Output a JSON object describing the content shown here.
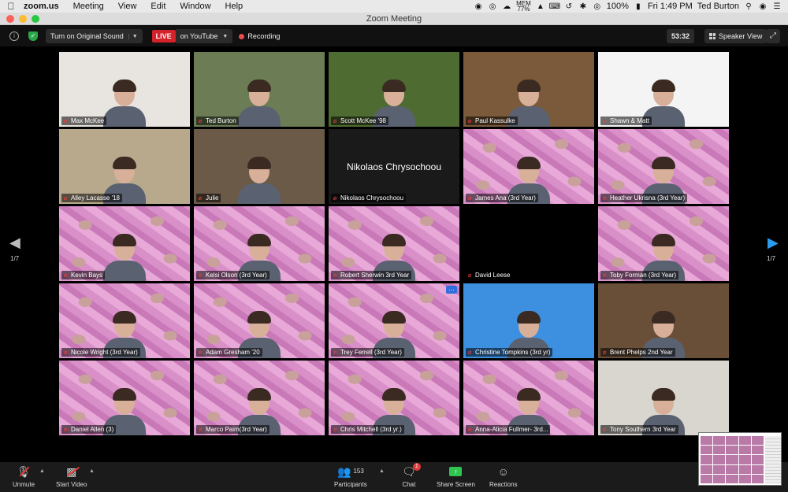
{
  "menubar": {
    "app": "zoom.us",
    "items": [
      "Meeting",
      "View",
      "Edit",
      "Window",
      "Help"
    ],
    "mem_label": "MEM",
    "mem_value": "77%",
    "battery": "100%",
    "datetime": "Fri 1:49 PM",
    "user": "Ted Burton"
  },
  "window": {
    "title": "Zoom Meeting"
  },
  "topbar": {
    "audio_button": "Turn on Original Sound",
    "live_badge": "LIVE",
    "live_target": "on YouTube",
    "recording": "Recording",
    "timer": "53:32",
    "view_button": "Speaker View"
  },
  "nav": {
    "page_left": "1/7",
    "page_right": "1/7"
  },
  "participants": [
    {
      "name": "Max McKee",
      "bg": "#e8e4df"
    },
    {
      "name": "Ted Burton",
      "bg": "#6c7d55"
    },
    {
      "name": "Scott McKee '98",
      "bg": "#4e6b32",
      "active": true
    },
    {
      "name": "Paul Kassulke",
      "bg": "#7a5a3a"
    },
    {
      "name": "Shawn & Matt",
      "bg": "#f4f4f4"
    },
    {
      "name": "Alley Lacasse '18",
      "bg": "#b9a98c"
    },
    {
      "name": "Julie",
      "bg": "#6b5a47"
    },
    {
      "name": "Nikolaos Chrysochoou",
      "video_off": true
    },
    {
      "name": "James Ana (3rd Year)",
      "pink": true
    },
    {
      "name": "Heather Ukrisna (3rd Year)",
      "pink": true
    },
    {
      "name": "Kevin Bays",
      "pink": true
    },
    {
      "name": "Kelsi Olson (3rd Year)",
      "pink": true
    },
    {
      "name": "Robert Sherwin 3rd Year",
      "pink": true
    },
    {
      "name": "David Leese",
      "black": true
    },
    {
      "name": "Toby Forman (3rd Year)",
      "pink": true
    },
    {
      "name": "Nicole Wright (3rd Year)",
      "pink": true
    },
    {
      "name": "Adam Gresham '20",
      "pink": true
    },
    {
      "name": "Trey Ferrell (3rd Year)",
      "pink": true,
      "more": true
    },
    {
      "name": "Christine Tompkins (3rd yr)",
      "bg": "#3d8fe0"
    },
    {
      "name": "Brent Phelps 2nd Year",
      "bg": "#6a4f38"
    },
    {
      "name": "Daniel Allen (3)",
      "pink": true
    },
    {
      "name": "Marco Paim(3rd Year)",
      "pink": true
    },
    {
      "name": "Chris Mitchell (3rd yr.)",
      "pink": true
    },
    {
      "name": "Anna-Alicia Fullmer- 3rd...",
      "pink": true
    },
    {
      "name": "Tony Southern 3rd Year",
      "bg": "#d9d6cf"
    }
  ],
  "bottombar": {
    "unmute": "Unmute",
    "start_video": "Start Video",
    "participants": "Participants",
    "participant_count": "153",
    "chat": "Chat",
    "chat_badge": "1",
    "share_screen": "Share Screen",
    "reactions": "Reactions"
  },
  "colors": {
    "live": "#d3222a",
    "active_speaker": "#e3e07a",
    "share": "#2fc34f",
    "nav_arrow": "#2a9cf2",
    "muted": "#ee3b3b"
  }
}
